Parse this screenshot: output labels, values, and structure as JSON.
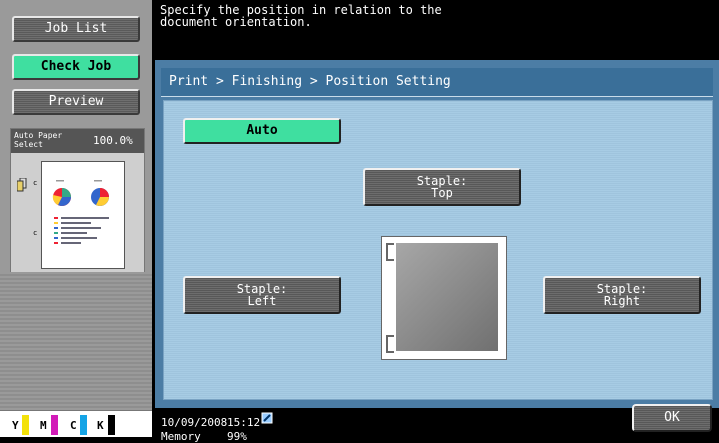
{
  "left_panel": {
    "job_list": "Job List",
    "check_job": "Check Job",
    "preview": "Preview",
    "paper_select_line1": "Auto Paper",
    "paper_select_line2": "Select",
    "zoom": "100.0%"
  },
  "toner": {
    "y": "Y",
    "m": "M",
    "c": "C",
    "k": "K"
  },
  "message": "Specify the position in relation to the\ndocument orientation.",
  "breadcrumb": "Print > Finishing > Position Setting",
  "buttons": {
    "auto": "Auto",
    "staple_top": "Staple:\nTop",
    "staple_left": "Staple:\nLeft",
    "staple_right": "Staple:\nRight",
    "ok": "OK"
  },
  "status": {
    "date": "10/09/2008",
    "time": "15:12",
    "memory_label": "Memory",
    "memory_value": "99%"
  },
  "colors": {
    "accent_green": "#3fdfa0",
    "panel_blue": "#4c7da5"
  }
}
